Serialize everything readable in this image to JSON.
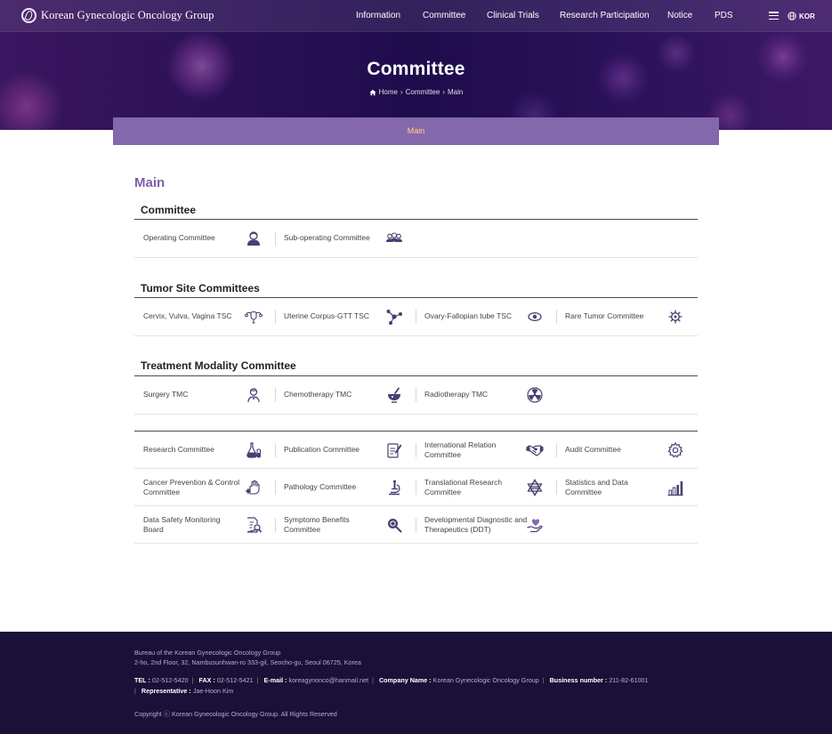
{
  "header": {
    "logo_text": "Korean Gynecologic Oncology Group",
    "nav": [
      "Information",
      "Committee",
      "Clinical Trials",
      "Research Participation",
      "Notice",
      "PDS"
    ],
    "lang": "KOR"
  },
  "hero": {
    "title": "Committee",
    "breadcrumb": [
      "Home",
      "Committee",
      "Main"
    ]
  },
  "tabs": {
    "active": "Main"
  },
  "main": {
    "title": "Main",
    "sections": [
      {
        "title": "Committee",
        "items": [
          {
            "label": "Operating Committee",
            "icon": "doctor-icon"
          },
          {
            "label": "Sub-operating Committee",
            "icon": "group-icon"
          }
        ]
      },
      {
        "title": "Tumor Site Committees",
        "items": [
          {
            "label": "Cervix, Vulva, Vagina TSC",
            "icon": "uterus-icon"
          },
          {
            "label": "Uterine Corpus-GTT TSC",
            "icon": "molecule-icon"
          },
          {
            "label": "Ovary-Fallopian tube TSC",
            "icon": "eye-icon"
          },
          {
            "label": "Rare Tumor Committee",
            "icon": "virus-icon"
          }
        ]
      },
      {
        "title": "Treatment Modality Committee",
        "items": [
          {
            "label": "Surgery TMC",
            "icon": "surgeon-icon"
          },
          {
            "label": "Chemotherapy TMC",
            "icon": "mortar-icon"
          },
          {
            "label": "Radiotherapy TMC",
            "icon": "radiation-icon"
          }
        ]
      },
      {
        "title": "",
        "items": [
          {
            "label": "Research Committee",
            "icon": "flask-icon"
          },
          {
            "label": "Publication Committee",
            "icon": "document-edit-icon"
          },
          {
            "label": "International Relation Committee",
            "icon": "handshake-icon"
          },
          {
            "label": "Audit Committee",
            "icon": "gear-icon"
          },
          {
            "label": "Cancer Prevention & Control Committee",
            "icon": "hand-shield-icon"
          },
          {
            "label": "Pathology Committee",
            "icon": "microscope-icon"
          },
          {
            "label": "Translational Research Committee",
            "icon": "star-of-life-icon"
          },
          {
            "label": "Statistics and Data Committee",
            "icon": "bar-chart-icon"
          },
          {
            "label": "Data Safety Monitoring Board",
            "icon": "report-search-icon"
          },
          {
            "label": "Symptomo Benefits Committee",
            "icon": "magnifier-icon"
          },
          {
            "label": "Developmental Diagnostic and Therapeutics (DDT)",
            "icon": "heart-hand-icon"
          }
        ]
      }
    ]
  },
  "footer": {
    "bureau": "Bureau of the Korean Gynecologic Oncology Group",
    "address": "2-ho, 2nd Floor, 32, Nambusunhwan-ro 333-gil, Seocho-gu, Seoul 06725, Korea",
    "contact": [
      {
        "label": "TEL :",
        "value": "02-512-5420"
      },
      {
        "label": "FAX :",
        "value": "02-512-5421"
      },
      {
        "label": "E-mail :",
        "value": "koreagynonco@hanmail.net"
      },
      {
        "label": "Company Name :",
        "value": "Korean Gynecologic Oncology Group"
      },
      {
        "label": "Business number :",
        "value": "211-82-61001"
      },
      {
        "label": "Representative :",
        "value": "Jae-Hoon Kim"
      }
    ],
    "copyright": "Copyright ⓒ Korean Gynecologic Oncology Group. All Rights Reserved"
  },
  "colors": {
    "accent": "#8368ac",
    "title": "#7d5fac",
    "icon": "#4b3f72",
    "footer_bg": "#1b1037",
    "active_tab_text": "#ffd58a"
  }
}
